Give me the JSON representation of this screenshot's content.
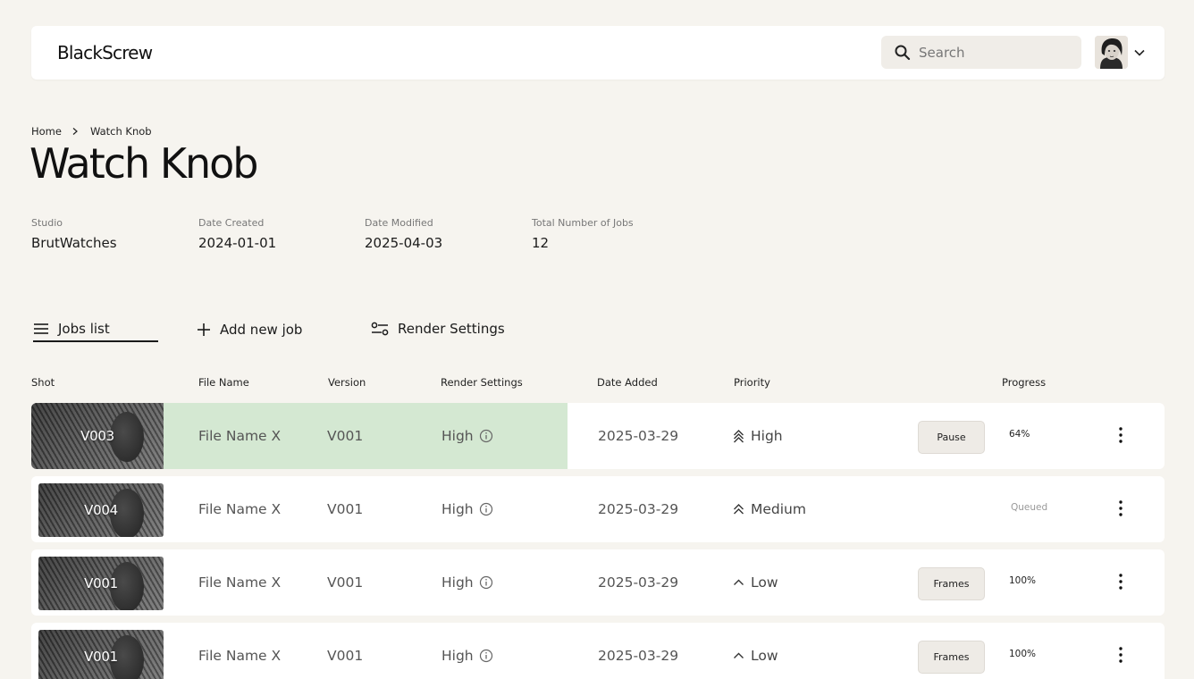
{
  "app": {
    "brand": "BlackScrew",
    "search_placeholder": "Search"
  },
  "breadcrumb": {
    "home": "Home",
    "current": "Watch Knob"
  },
  "page": {
    "title": "Watch Knob"
  },
  "meta": [
    {
      "label": "Studio",
      "value": "BrutWatches"
    },
    {
      "label": "Date Created",
      "value": "2024-01-01"
    },
    {
      "label": "Date Modified",
      "value": "2025-04-03"
    },
    {
      "label": "Total Number of Jobs",
      "value": "12"
    }
  ],
  "tabs": {
    "jobs_list": "Jobs list",
    "add_new_job": "Add new job",
    "render_settings": "Render Settings",
    "active": "jobs_list"
  },
  "table": {
    "headers": {
      "shot": "Shot",
      "file_name": "File Name",
      "version": "Version",
      "render_settings": "Render Settings",
      "date_added": "Date Added",
      "priority": "Priority",
      "progress": "Progress"
    },
    "rows": [
      {
        "shot": "V003",
        "file_name": "File Name X",
        "version": "V001",
        "render": "High",
        "date": "2025-03-29",
        "priority": "High",
        "priority_icon": "double-chevron-up-icon",
        "action": "Pause",
        "progress": "64%",
        "highlight_color": "#d4e8d2"
      },
      {
        "shot": "V004",
        "file_name": "File Name X",
        "version": "V001",
        "render": "High",
        "date": "2025-03-29",
        "priority": "Medium",
        "priority_icon": "double-chevron-up-icon",
        "action": "",
        "progress": "Queued"
      },
      {
        "shot": "V001",
        "file_name": "File Name X",
        "version": "V001",
        "render": "High",
        "date": "2025-03-29",
        "priority": "Low",
        "priority_icon": "chevron-up-icon",
        "action": "Frames",
        "progress": "100%"
      },
      {
        "shot": "V001",
        "file_name": "File Name X",
        "version": "V001",
        "render": "High",
        "date": "2025-03-29",
        "priority": "Low",
        "priority_icon": "chevron-up-icon",
        "action": "Frames",
        "progress": "100%"
      }
    ]
  }
}
